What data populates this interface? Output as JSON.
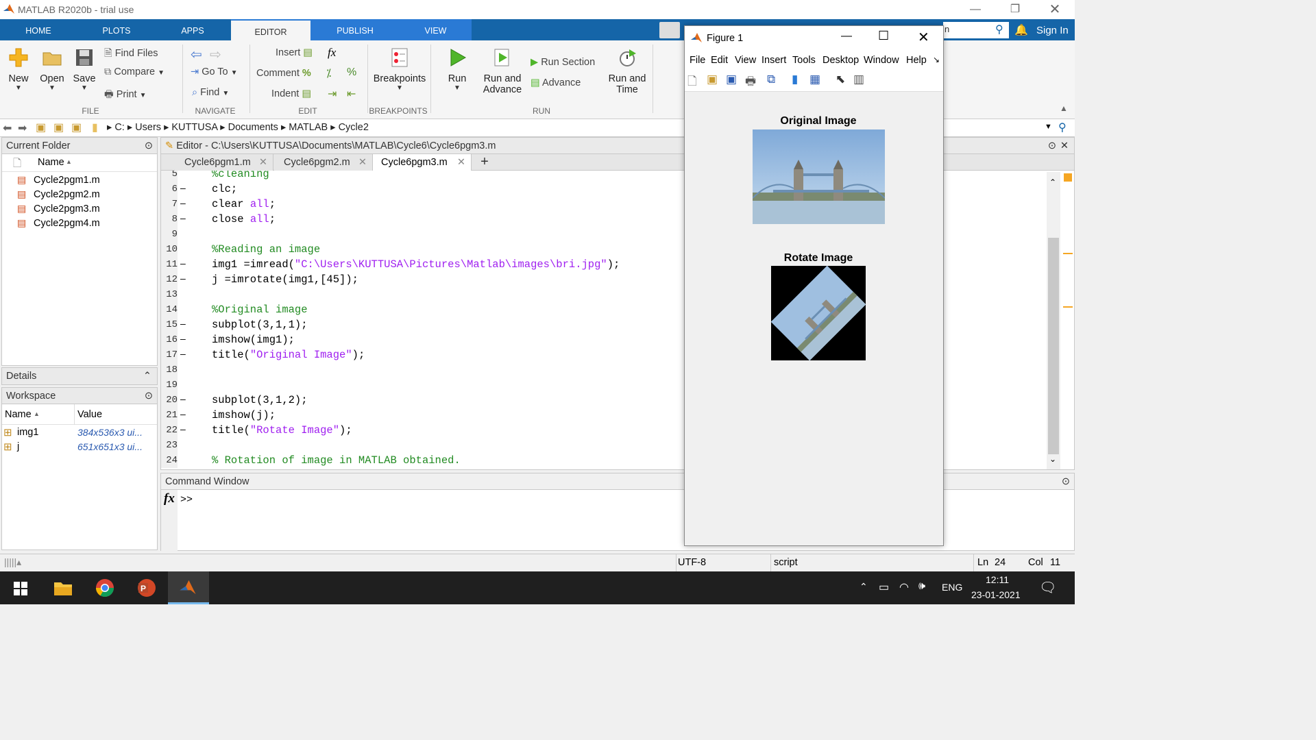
{
  "app": {
    "title": "MATLAB R2020b - trial use"
  },
  "tabs": [
    "HOME",
    "PLOTS",
    "APPS",
    "EDITOR",
    "PUBLISH",
    "VIEW"
  ],
  "active_tab": "EDITOR",
  "sign_in": "Sign In",
  "search": {
    "placeholder": "n"
  },
  "ribbon": {
    "file": {
      "new": "New",
      "open": "Open",
      "save": "Save",
      "find_files": "Find Files",
      "compare": "Compare",
      "print": "Print",
      "label": "FILE"
    },
    "navigate": {
      "goto": "Go To",
      "find": "Find",
      "label": "NAVIGATE"
    },
    "edit": {
      "insert": "Insert",
      "comment": "Comment",
      "indent": "Indent",
      "fx": "fx",
      "pct": "%",
      "label": "EDIT"
    },
    "breakpoints": {
      "btn": "Breakpoints",
      "label": "BREAKPOINTS"
    },
    "run": {
      "run": "Run",
      "run_advance_1": "Run and",
      "run_advance_2": "Advance",
      "run_section": "Run Section",
      "advance": "Advance",
      "run_time_1": "Run and",
      "run_time_2": "Time",
      "label": "RUN"
    }
  },
  "address": {
    "parts": [
      "C:",
      "Users",
      "KUTTUSA",
      "Documents",
      "MATLAB",
      "Cycle2"
    ]
  },
  "current_folder": {
    "title": "Current Folder",
    "col_name": "Name",
    "files": [
      "Cycle2pgm1.m",
      "Cycle2pgm2.m",
      "Cycle2pgm3.m",
      "Cycle2pgm4.m"
    ]
  },
  "details": {
    "title": "Details"
  },
  "workspace": {
    "title": "Workspace",
    "col_name": "Name",
    "col_value": "Value",
    "vars": [
      {
        "name": "img1",
        "value": "384x536x3 ui..."
      },
      {
        "name": "j",
        "value": "651x651x3 ui..."
      }
    ]
  },
  "editor": {
    "title": "Editor - C:\\Users\\KUTTUSA\\Documents\\MATLAB\\Cycle6\\Cycle6pgm3.m",
    "tabs": [
      "Cycle6pgm1.m",
      "Cycle6pgm2.m",
      "Cycle6pgm3.m"
    ],
    "active_tab": "Cycle6pgm3.m",
    "add_tab": "+",
    "lines": [
      {
        "n": "5",
        "dash": "",
        "code": "%cleaning"
      },
      {
        "n": "6",
        "dash": "–",
        "code": "clc;"
      },
      {
        "n": "7",
        "dash": "–",
        "code": "clear all;"
      },
      {
        "n": "8",
        "dash": "–",
        "code": "close all;"
      },
      {
        "n": "9",
        "dash": "",
        "code": ""
      },
      {
        "n": "10",
        "dash": "",
        "code": "%Reading an image"
      },
      {
        "n": "11",
        "dash": "–",
        "code": "img1 =imread(\"C:\\Users\\KUTTUSA\\Pictures\\Matlab\\images\\bri.jpg\");"
      },
      {
        "n": "12",
        "dash": "–",
        "code": "j =imrotate(img1,[45]);"
      },
      {
        "n": "13",
        "dash": "",
        "code": ""
      },
      {
        "n": "14",
        "dash": "",
        "code": "%Original image"
      },
      {
        "n": "15",
        "dash": "–",
        "code": "subplot(3,1,1);"
      },
      {
        "n": "16",
        "dash": "–",
        "code": "imshow(img1);"
      },
      {
        "n": "17",
        "dash": "–",
        "code": "title(\"Original Image\");"
      },
      {
        "n": "18",
        "dash": "",
        "code": ""
      },
      {
        "n": "19",
        "dash": "",
        "code": ""
      },
      {
        "n": "20",
        "dash": "–",
        "code": "subplot(3,1,2);"
      },
      {
        "n": "21",
        "dash": "–",
        "code": "imshow(j);"
      },
      {
        "n": "22",
        "dash": "–",
        "code": "title(\"Rotate Image\");"
      },
      {
        "n": "23",
        "dash": "",
        "code": ""
      },
      {
        "n": "24",
        "dash": "",
        "code": "% Rotation of image in MATLAB obtained."
      }
    ]
  },
  "command_window": {
    "title": "Command Window",
    "fx": "fx",
    "prompt": ">>"
  },
  "figure": {
    "title": "Figure 1",
    "menu": [
      "File",
      "Edit",
      "View",
      "Insert",
      "Tools",
      "Desktop",
      "Window",
      "Help"
    ],
    "plot1_title": "Original Image",
    "plot2_title": "Rotate Image"
  },
  "status": {
    "encoding": "UTF-8",
    "type": "script",
    "ln_label": "Ln",
    "ln": "24",
    "col_label": "Col",
    "col": "11"
  },
  "taskbar": {
    "lang": "ENG",
    "time": "12:11",
    "date": "23-01-2021"
  },
  "colors": {
    "tabbar": "#1565a8",
    "comment": "#228b22",
    "string": "#a020f0"
  }
}
